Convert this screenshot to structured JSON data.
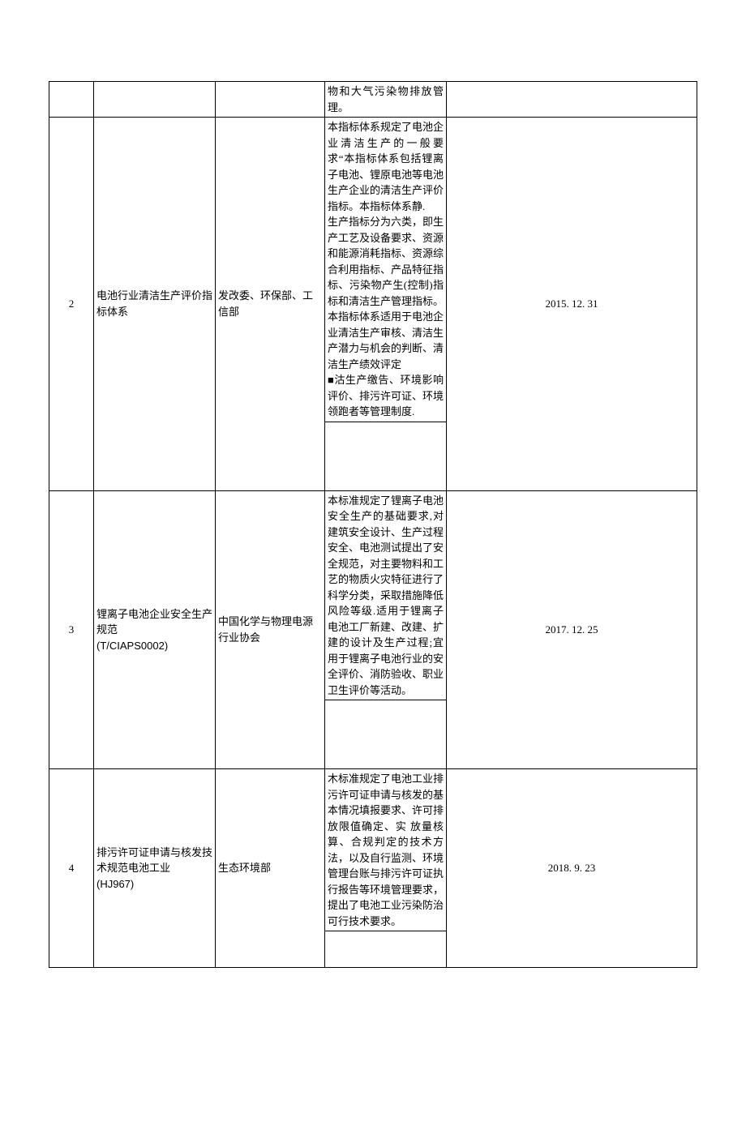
{
  "rows": [
    {
      "idx": "",
      "name": "",
      "issuer": "",
      "desc": "物和大气污染物排放管理。",
      "date": ""
    },
    {
      "idx": "2",
      "name": "电池行业清洁生产评价指标体系",
      "issuer": "发改委、环保部、工信部",
      "desc": "本指标体系规定了电池企业清洁生产的一般要求“本指标体系包括锂离子电池、锂原电池等电池生产企业的清洁生产评价指标。本指标体系静.\n生产指标分为六类，即生产工艺及设备要求、资源和能源消耗指标、资源综合利用指标、产品特征指标、污染物产生(控制)指标和清洁生产管理指标。\n本指标体系适用于电池企业清洁生产审核、清洁生产潜力与机会的判断、清洁生产绩效评定\n■沽生产缴告、环境影响评价、排污许可证、环境领跑者等管理制度.",
      "date": "2015. 12. 31"
    },
    {
      "idx": "3",
      "name_line1": "锂离子电池企业安全生产规范",
      "name_line2": "(T/CIAPS0002)",
      "issuer": "中国化学与物理电源行业协会",
      "desc": "本标准规定了锂离子电池安全生产的基础要求,对建筑安全设计、生产过程安全、电池测试提出了安全规范，对主要物料和工艺的物质火灾特征进行了科学分类，采取措施降低风险等级.适用于锂离子电池工厂新建、改建、扩建的设计及生产过程;宜用于锂离子电池行业的安全评价、消防验收、职业卫生评价等活动。",
      "date": "2017. 12. 25"
    },
    {
      "idx": "4",
      "name_line1": "排污许可证申请与核发技术规范电池工业",
      "name_line2": "(HJ967)",
      "issuer": "生态环境部",
      "desc": "木标准规定了电池工业排污许可证申请与核发的基本情况填报要求、许可排放限值确定、实   放量核算、合规判定的技术方法，以及自行监测、环境管理台账与排污许可证执行报告等环境管理要求，提出了电池工业污染防治可行技术要求。",
      "date": "2018. 9. 23"
    }
  ]
}
